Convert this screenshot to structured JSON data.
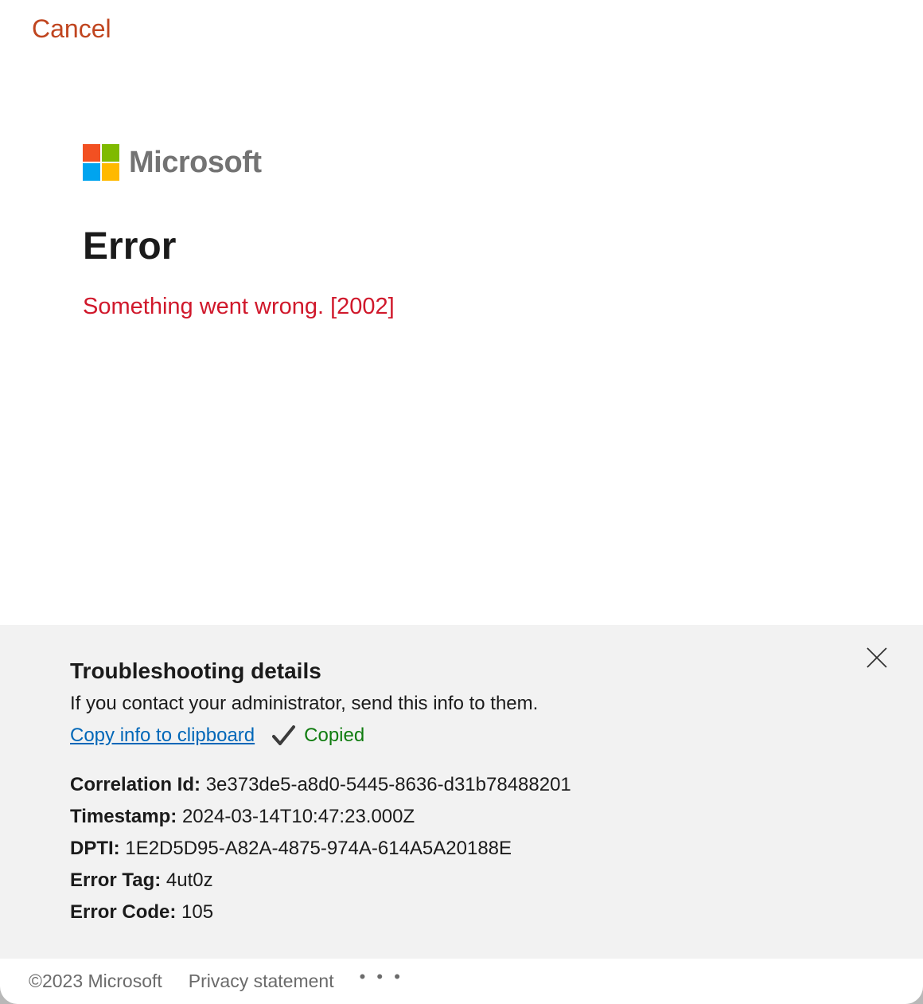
{
  "header": {
    "cancel_label": "Cancel"
  },
  "brand": {
    "logo_icon": "microsoft-four-squares-icon",
    "wordmark": "Microsoft",
    "colors": {
      "red": "#f25022",
      "green": "#7fba00",
      "blue": "#00a4ef",
      "yellow": "#ffb900"
    }
  },
  "main": {
    "title": "Error",
    "message": "Something went wrong. [2002]",
    "message_color": "#d0182b"
  },
  "troubleshooting": {
    "title": "Troubleshooting details",
    "description": "If you contact your administrator, send this info to them.",
    "copy_link": "Copy info to clipboard",
    "copied_status": "Copied",
    "copied_icon": "checkmark-icon",
    "close_icon": "close-icon",
    "details": [
      {
        "label": "Correlation Id:",
        "value": "3e373de5-a8d0-5445-8636-d31b78488201"
      },
      {
        "label": "Timestamp:",
        "value": "2024-03-14T10:47:23.000Z"
      },
      {
        "label": "DPTI:",
        "value": "1E2D5D95-A82A-4875-974A-614A5A20188E"
      },
      {
        "label": "Error Tag:",
        "value": "4ut0z"
      },
      {
        "label": "Error Code:",
        "value": "105"
      }
    ]
  },
  "footer": {
    "copyright": "©2023 Microsoft",
    "privacy": "Privacy statement",
    "more": "• • •"
  }
}
